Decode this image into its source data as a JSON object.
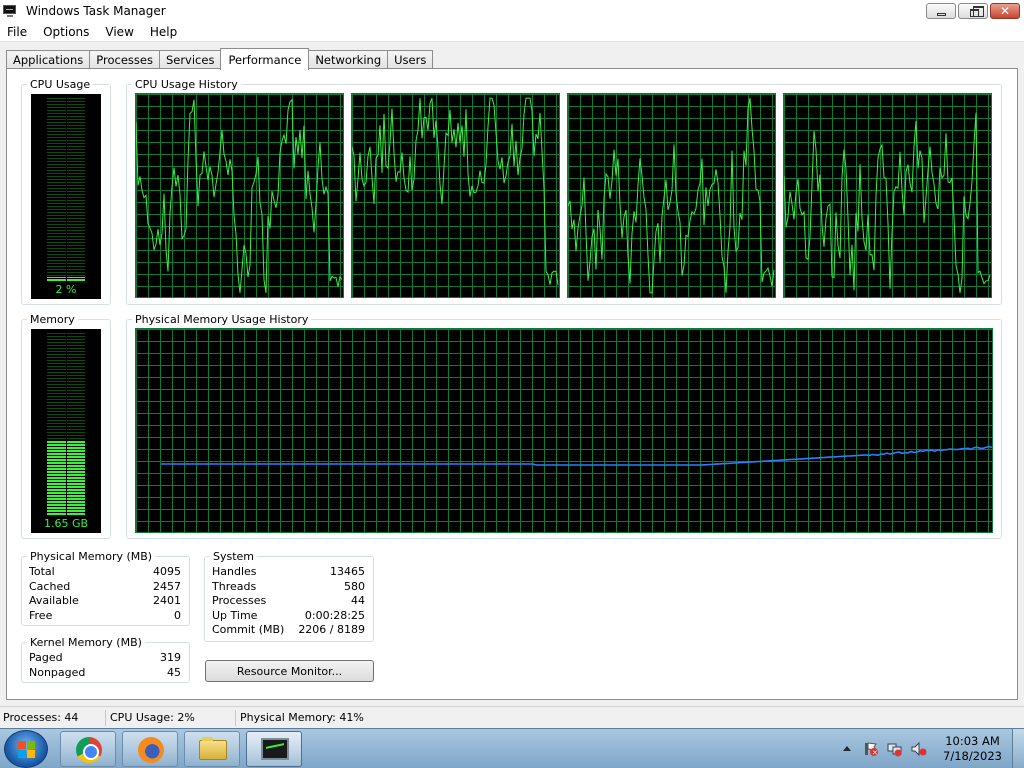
{
  "window": {
    "title": "Windows Task Manager"
  },
  "menu": [
    "File",
    "Options",
    "View",
    "Help"
  ],
  "tabs": [
    "Applications",
    "Processes",
    "Services",
    "Performance",
    "Networking",
    "Users"
  ],
  "active_tab": "Performance",
  "cpu_usage": {
    "label": "CPU Usage",
    "value_text": "2 %",
    "value": 2
  },
  "cpu_history": {
    "label": "CPU Usage History",
    "cores": 4
  },
  "memory": {
    "label": "Memory",
    "value_text": "1.65 GB",
    "fraction": 0.41
  },
  "memory_history": {
    "label": "Physical Memory Usage History"
  },
  "physical_memory": {
    "label": "Physical Memory (MB)",
    "rows": [
      {
        "k": "Total",
        "v": "4095"
      },
      {
        "k": "Cached",
        "v": "2457"
      },
      {
        "k": "Available",
        "v": "2401"
      },
      {
        "k": "Free",
        "v": "0"
      }
    ]
  },
  "kernel_memory": {
    "label": "Kernel Memory (MB)",
    "rows": [
      {
        "k": "Paged",
        "v": "319"
      },
      {
        "k": "Nonpaged",
        "v": "45"
      }
    ]
  },
  "system": {
    "label": "System",
    "rows": [
      {
        "k": "Handles",
        "v": "13465"
      },
      {
        "k": "Threads",
        "v": "580"
      },
      {
        "k": "Processes",
        "v": "44"
      },
      {
        "k": "Up Time",
        "v": "0:00:28:25"
      },
      {
        "k": "Commit (MB)",
        "v": "2206 / 8189"
      }
    ]
  },
  "resource_monitor_label": "Resource Monitor...",
  "status": {
    "processes": "Processes: 44",
    "cpu": "CPU Usage: 2%",
    "memory": "Physical Memory: 41%"
  },
  "taskbar": {
    "items": [
      "chrome-icon",
      "firefox-icon",
      "file-explorer-icon",
      "task-manager-icon"
    ],
    "time": "10:03 AM",
    "date": "7/18/2023"
  },
  "colors": {
    "graph_line": "#3cf03c",
    "graph_grid": "#0e7a3a",
    "memory_line": "#2a7fff"
  }
}
